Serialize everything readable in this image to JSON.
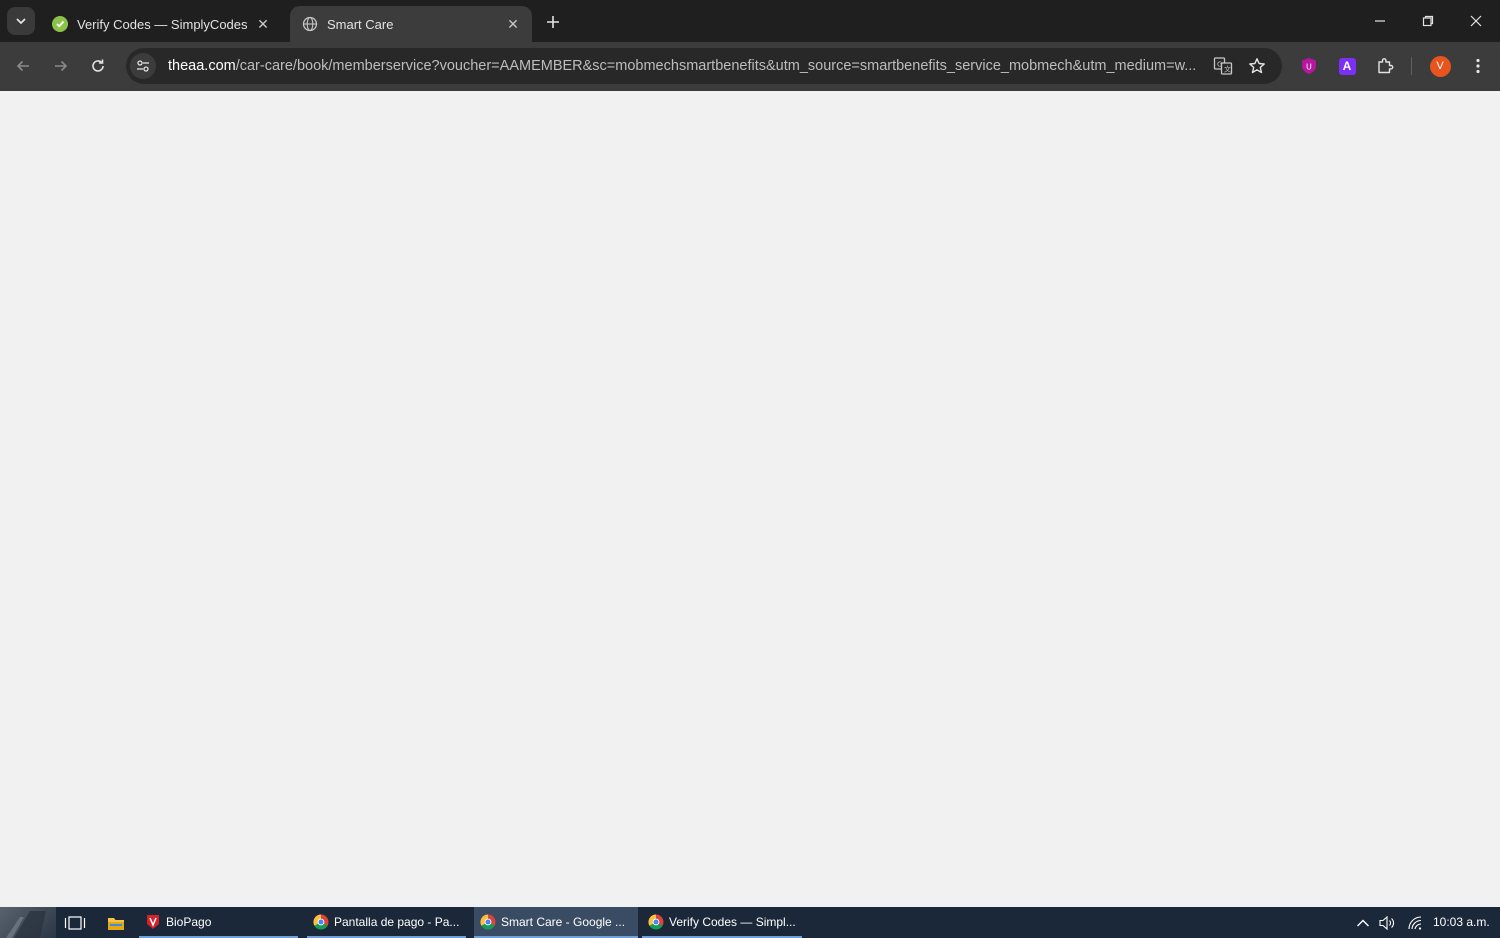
{
  "browser": {
    "tabs": [
      {
        "title": "Verify Codes — SimplyCodes",
        "close": "✕",
        "favicon": "simplycodes-icon"
      },
      {
        "title": "Smart Care",
        "close": "✕",
        "favicon": "globe-icon"
      }
    ],
    "url_host": "theaa.com",
    "url_path": "/car-care/book/memberservice?voucher=AAMEMBER&sc=mobmechsmartbenefits&utm_source=smartbenefits_service_mobmech&utm_medium=w...",
    "profile_initial": "V",
    "extension_a_label": "A",
    "extension_u_label": "U"
  },
  "taskbar": {
    "apps": [
      {
        "label": "BioPago",
        "icon": "biopago-icon"
      },
      {
        "label": "Pantalla de pago - Pa...",
        "icon": "chrome-icon"
      },
      {
        "label": "Smart Care - Google ...",
        "icon": "chrome-icon"
      },
      {
        "label": "Verify Codes — Simpl...",
        "icon": "chrome-icon"
      }
    ],
    "clock": "10:03 a.m."
  },
  "colors": {
    "accent_profile": "#e8541e",
    "content_bg": "#f1f1f1",
    "taskbar_bg": "#1b2839"
  }
}
